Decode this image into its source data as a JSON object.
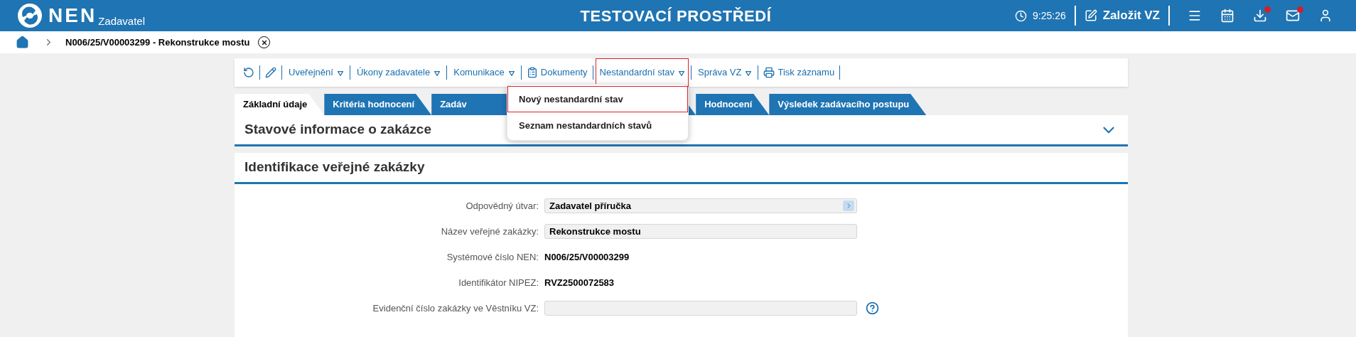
{
  "header": {
    "logo": "NEN",
    "subtitle": "Zadavatel",
    "title": "TESTOVACÍ PROSTŘEDÍ",
    "time": "9:25:26",
    "create_button": "Založit VZ",
    "icons": [
      {
        "kind": "menu",
        "badge": false
      },
      {
        "kind": "calendar",
        "badge": false
      },
      {
        "kind": "download",
        "badge": true
      },
      {
        "kind": "mail",
        "badge": true
      },
      {
        "kind": "user",
        "badge": false
      }
    ]
  },
  "breadcrumb": {
    "current": "N006/25/V00003299 - Rekonstrukce mostu"
  },
  "toolbar": [
    {
      "kind": "refresh"
    },
    {
      "kind": "edit"
    },
    {
      "kind": "menu",
      "label": "Uveřejnění",
      "expanded": false
    },
    {
      "kind": "menu",
      "label": "Úkony zadavatele",
      "expanded": false
    },
    {
      "kind": "menu",
      "label": "Komunikace",
      "expanded": false
    },
    {
      "kind": "documents",
      "label": "Dokumenty"
    },
    {
      "kind": "menu",
      "label": "Nestandardní stav",
      "expanded": true,
      "items": [
        {
          "label": "Nový nestandardní stav",
          "selected": true
        },
        {
          "label": "Seznam nestandardních stavů",
          "selected": false
        }
      ]
    },
    {
      "kind": "menu",
      "label": "Správa VZ",
      "expanded": false
    },
    {
      "kind": "print",
      "label": "Tisk záznamu"
    }
  ],
  "tabs": [
    {
      "label": "Základní údaje",
      "selected": true
    },
    {
      "label": "Kritéria hodnocení",
      "selected": false
    },
    {
      "label": "Zadáv",
      "selected": false,
      "covered": true
    },
    {
      "label": "Hodnocení",
      "selected": false
    },
    {
      "label": "Výsledek zadávacího postupu",
      "selected": false
    }
  ],
  "sections": [
    {
      "title": "Stavové informace o zakázce",
      "expanded": false
    },
    {
      "title": "Identifikace veřejné zakázky",
      "expanded": true,
      "rows": [
        {
          "label": "Odpovědný útvar:",
          "kind": "select",
          "value": "Zadavatel příručka"
        },
        {
          "label": "Název veřejné zakázky:",
          "kind": "field",
          "value": "Rekonstrukce mostu"
        },
        {
          "label": "Systémové číslo NEN:",
          "kind": "text",
          "value": "N006/25/V00003299"
        },
        {
          "label": "Identifikátor NIPEZ:",
          "kind": "text",
          "value": "RVZ2500072583"
        },
        {
          "label": "Evidenční číslo zakázky ve Věstníku VZ:",
          "kind": "field",
          "help": true
        }
      ]
    }
  ]
}
